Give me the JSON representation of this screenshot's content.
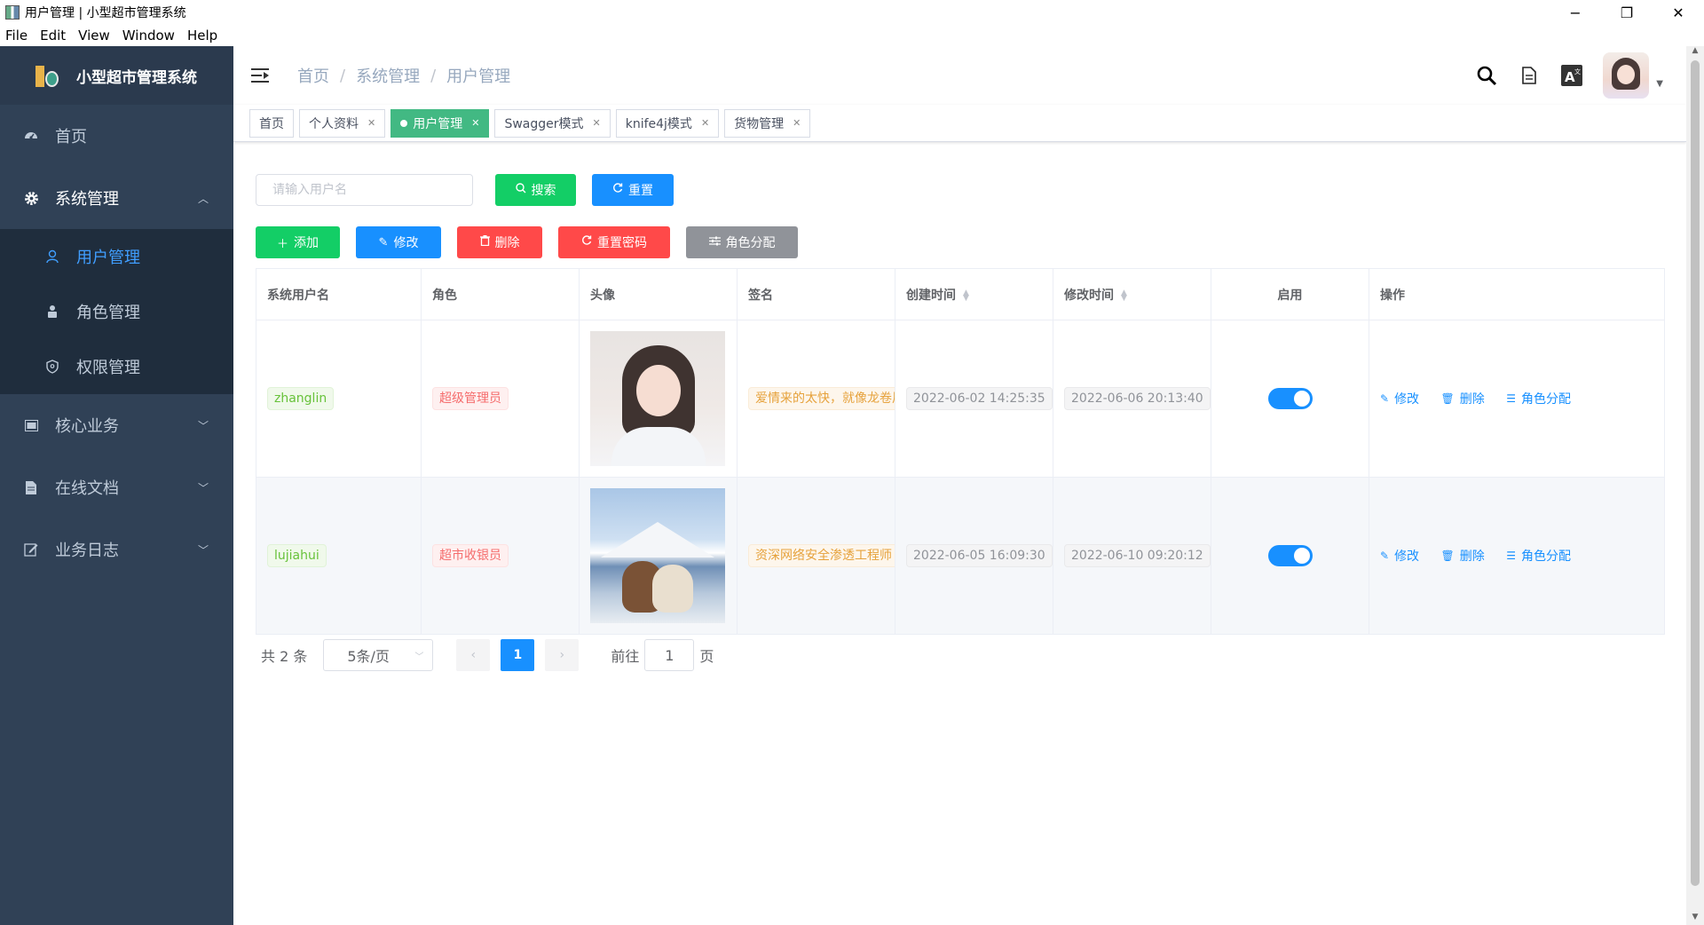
{
  "window": {
    "title": "用户管理 | 小型超市管理系统",
    "minimize": "−",
    "maximize": "❐",
    "close": "✕"
  },
  "menubar": [
    "File",
    "Edit",
    "View",
    "Window",
    "Help"
  ],
  "sidebar": {
    "logo_text": "小型超市管理系统",
    "items": [
      {
        "label": "首页",
        "icon": "dashboard-icon"
      },
      {
        "label": "系统管理",
        "icon": "gear-icon",
        "expanded": true
      },
      {
        "label": "核心业务",
        "icon": "image-icon"
      },
      {
        "label": "在线文档",
        "icon": "document-icon"
      },
      {
        "label": "业务日志",
        "icon": "edit-log-icon"
      }
    ],
    "submenu": [
      {
        "label": "用户管理",
        "icon": "user-icon",
        "active": true
      },
      {
        "label": "角色管理",
        "icon": "role-icon"
      },
      {
        "label": "权限管理",
        "icon": "shield-icon"
      }
    ]
  },
  "breadcrumb": [
    "首页",
    "系统管理",
    "用户管理"
  ],
  "tags": [
    {
      "label": "首页",
      "closable": false
    },
    {
      "label": "个人资料",
      "closable": true
    },
    {
      "label": "用户管理",
      "closable": true,
      "active": true
    },
    {
      "label": "Swagger模式",
      "closable": true
    },
    {
      "label": "knife4j模式",
      "closable": true
    },
    {
      "label": "货物管理",
      "closable": true
    }
  ],
  "search": {
    "placeholder": "请输入用户名",
    "search_label": "搜索",
    "reset_label": "重置"
  },
  "toolbar": {
    "add": "添加",
    "edit": "修改",
    "delete": "删除",
    "reset_password": "重置密码",
    "assign_role": "角色分配"
  },
  "table": {
    "columns": [
      "系统用户名",
      "角色",
      "头像",
      "签名",
      "创建时间",
      "修改时间",
      "启用",
      "操作"
    ],
    "rows": [
      {
        "username": "zhanglin",
        "role": "超级管理员",
        "signature": "爱情来的太快，就像龙卷风",
        "created": "2022-06-02 14:25:35",
        "modified": "2022-06-06 20:13:40",
        "enabled": true
      },
      {
        "username": "lujiahui",
        "role": "超市收银员",
        "signature": "资深网络安全渗透工程师",
        "created": "2022-06-05 16:09:30",
        "modified": "2022-06-10 09:20:12",
        "enabled": true
      }
    ],
    "ops": {
      "edit": "修改",
      "delete": "删除",
      "assign": "角色分配"
    },
    "ellipsis": "..."
  },
  "pagination": {
    "total_text": "共 2 条",
    "page_size": "5条/页",
    "current_page": "1",
    "goto_prefix": "前往",
    "goto_value": "1",
    "goto_suffix": "页"
  },
  "colors": {
    "sidebar_bg": "#304156",
    "accent": "#1890ff",
    "success": "#13ce66",
    "danger": "#ff4949",
    "tag_active": "#42b983"
  }
}
